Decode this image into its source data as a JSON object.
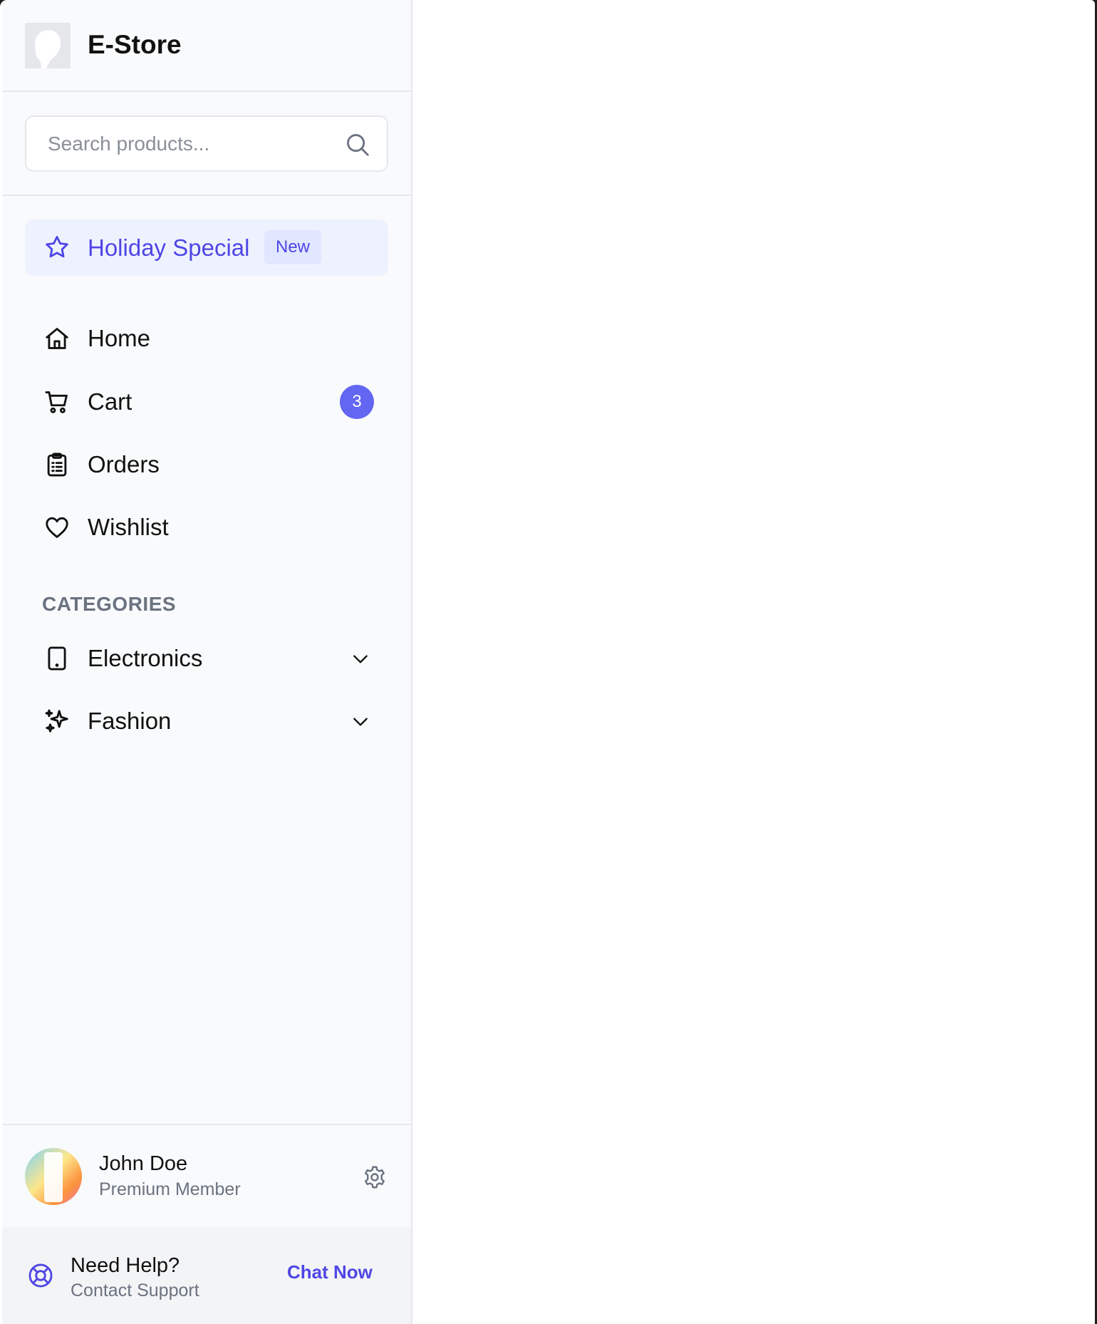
{
  "brand": {
    "name": "E-Store"
  },
  "search": {
    "placeholder": "Search products..."
  },
  "promo": {
    "label": "Holiday Special",
    "badge": "New",
    "color": "#4f46e5",
    "icon": "star-icon"
  },
  "nav": {
    "items": [
      {
        "label": "Home",
        "icon": "home-icon"
      },
      {
        "label": "Cart",
        "icon": "cart-icon",
        "badge": "3"
      },
      {
        "label": "Orders",
        "icon": "clipboard-icon"
      },
      {
        "label": "Wishlist",
        "icon": "heart-icon"
      }
    ]
  },
  "categories": {
    "title": "CATEGORIES",
    "items": [
      {
        "label": "Electronics",
        "icon": "tablet-icon",
        "expand_icon": "chevron-down-icon"
      },
      {
        "label": "Fashion",
        "icon": "sparkles-icon",
        "expand_icon": "chevron-down-icon"
      }
    ]
  },
  "user": {
    "name": "John Doe",
    "role": "Premium Member",
    "settings_icon": "gear-icon"
  },
  "help": {
    "title": "Need Help?",
    "subtitle": "Contact Support",
    "action": "Chat Now",
    "icon": "lifebuoy-icon"
  },
  "colors": {
    "accent": "#4f46e5",
    "badge": "#6366f1",
    "sidebar_bg": "#f8fafc"
  }
}
